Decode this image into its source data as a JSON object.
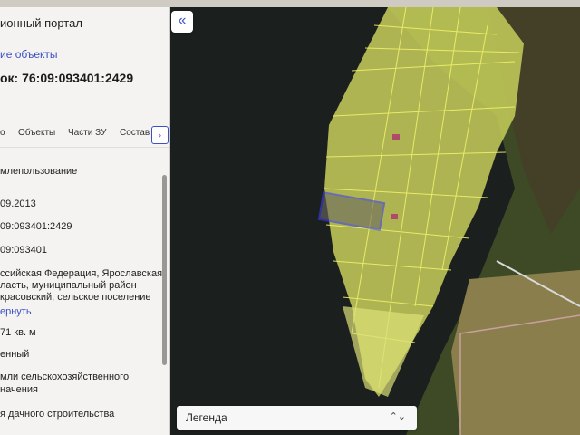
{
  "left_panel": {
    "title": "ионный портал",
    "back_link": "ие объекты",
    "parcel_id": "ок: 76:09:093401:2429",
    "tabs": [
      {
        "label": "о"
      },
      {
        "label": "Объекты"
      },
      {
        "label": "Части ЗУ"
      },
      {
        "label": "Состав"
      }
    ],
    "tab_arrow": "›",
    "fields": [
      {
        "text": "млепользование"
      },
      {
        "text": "09.2013"
      },
      {
        "text": "09:093401:2429"
      },
      {
        "text": "09:093401"
      },
      {
        "text": "ссийская Федерация, Ярославская"
      },
      {
        "text": "ласть, муниципальный район"
      },
      {
        "text": "красовский, сельское поселение"
      },
      {
        "text": "ернуть"
      },
      {
        "text": "71 кв. м"
      },
      {
        "text": "енный"
      },
      {
        "text": "мли сельскохозяйственного"
      },
      {
        "text": "начения"
      },
      {
        "text": "я дачного строительства"
      }
    ]
  },
  "map": {
    "collapse_icon": "«",
    "legend_label": "Легенда",
    "legend_icon": "⌃⌄",
    "colors": {
      "water": "#1b1f1d",
      "parcel_fill": "#d9e26a",
      "parcel_line": "#f0f06a",
      "selected_outline": "#3b3df5",
      "forest": "#3a4a22"
    }
  }
}
